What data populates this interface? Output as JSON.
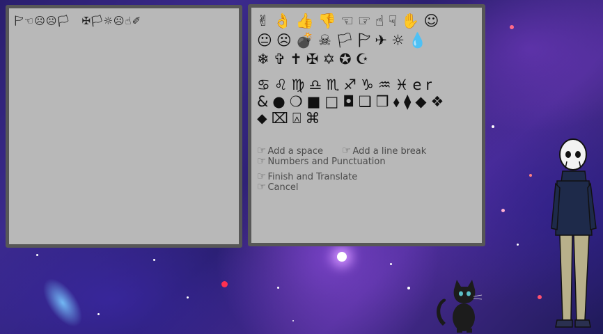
{
  "typed_text": "🏱☜☹☹🏳   ✠🏳☼☹☝✐",
  "glyph_rows": [
    [
      "✌",
      "👌",
      "👍",
      "👎",
      "☜",
      "☞",
      "☝",
      "☟",
      "✋",
      "☺"
    ],
    [
      "😐",
      "☹",
      "💣",
      "☠",
      "🏳",
      "🏱",
      "✈",
      "☼",
      "💧"
    ],
    [
      "❄",
      "✞",
      "✝",
      "✠",
      "✡",
      "✪",
      "☪"
    ],
    [
      "♋",
      "♌",
      "♍",
      "♎",
      "♏",
      "♐",
      "♑",
      "♒",
      "♓",
      "er"
    ],
    [
      "&",
      "●",
      "❍",
      "■",
      "□",
      "◘",
      "❑",
      "❒",
      "⬧",
      "⧫",
      "◆",
      "❖"
    ],
    [
      "⬥",
      "⌧",
      "⍓",
      "⌘"
    ]
  ],
  "options": {
    "add_space": "Add a space",
    "add_line_break": "Add a line break",
    "numbers_punct": "Numbers and Punctuation",
    "finish": "Finish and Translate",
    "cancel": "Cancel"
  },
  "pointer_glyph": "☞"
}
